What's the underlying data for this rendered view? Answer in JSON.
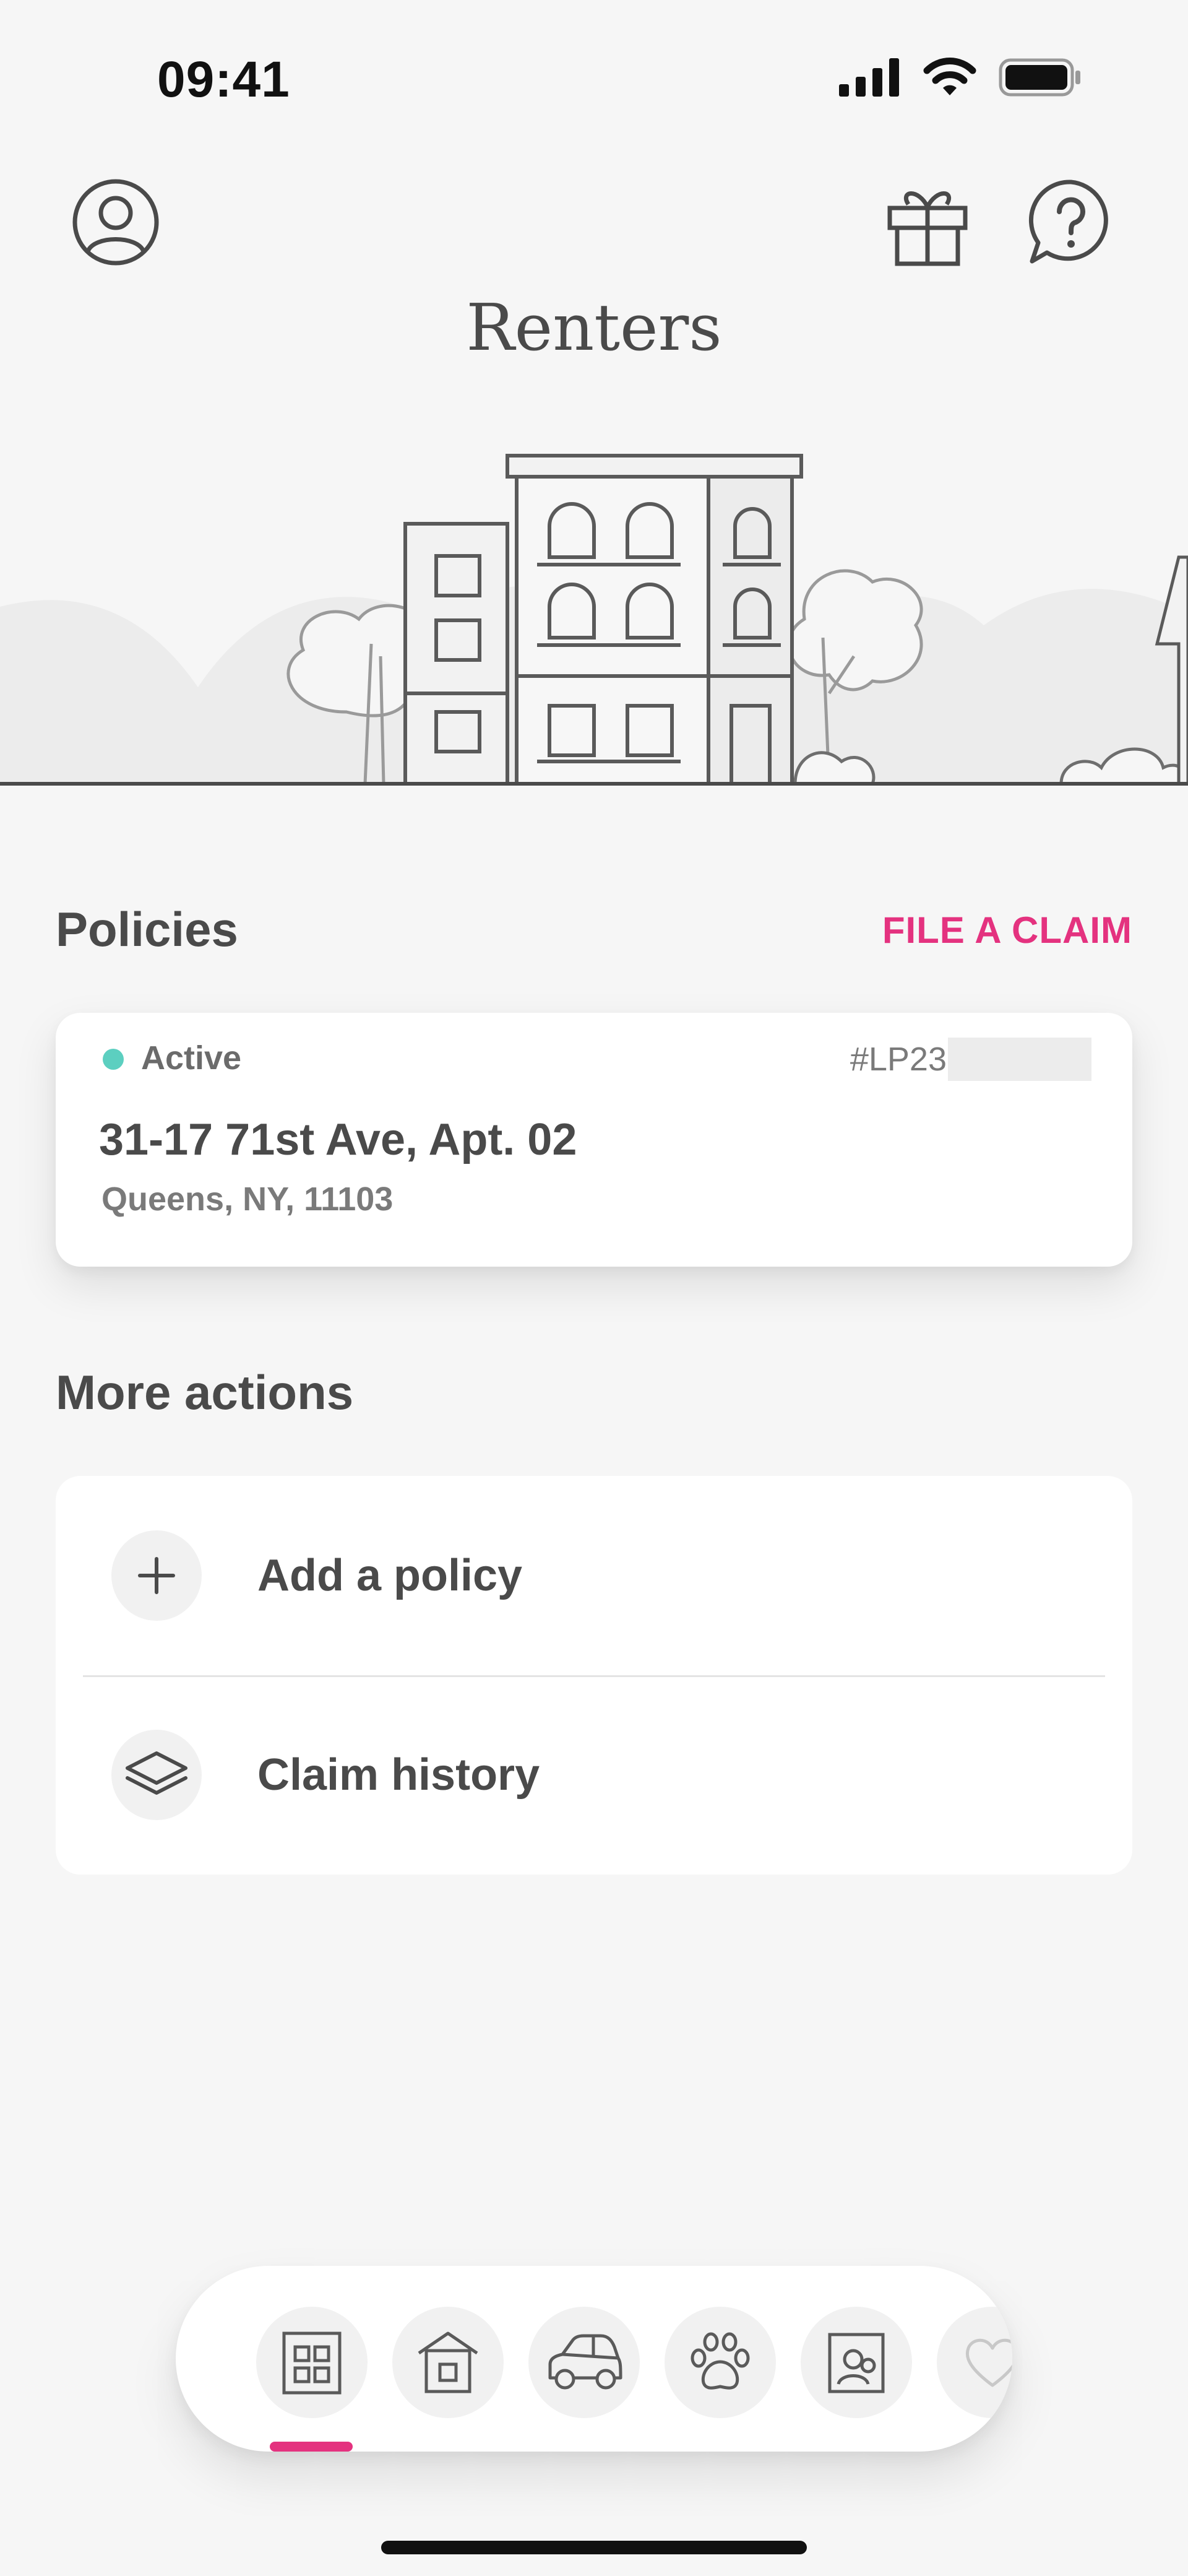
{
  "status_bar": {
    "time": "09:41"
  },
  "header": {
    "title": "Renters",
    "icons": [
      "profile-icon",
      "gift-icon",
      "help-icon"
    ]
  },
  "policies": {
    "heading": "Policies",
    "file_claim_label": "FILE A CLAIM",
    "card": {
      "status": "Active",
      "status_color": "#5ccfc0",
      "policy_number": "#LP23",
      "address_line1": "31-17 71st Ave, Apt. 02",
      "address_line2": "Queens, NY, 11103"
    }
  },
  "more_actions": {
    "heading": "More actions",
    "items": [
      {
        "label": "Add a policy",
        "icon": "plus-icon"
      },
      {
        "label": "Claim history",
        "icon": "layers-icon"
      }
    ]
  },
  "tab_bar": {
    "tabs": [
      {
        "icon": "renters-building-icon",
        "selected": true
      },
      {
        "icon": "home-icon",
        "selected": false
      },
      {
        "icon": "car-icon",
        "selected": false
      },
      {
        "icon": "paw-icon",
        "selected": false
      },
      {
        "icon": "term-life-icon",
        "selected": false
      },
      {
        "icon": "heart-icon",
        "selected": false
      }
    ],
    "accent_color": "#e4327f"
  }
}
